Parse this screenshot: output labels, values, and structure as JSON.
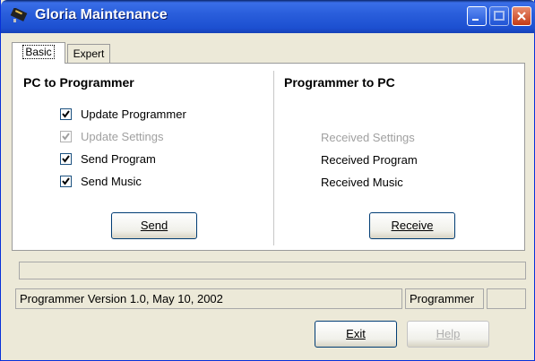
{
  "window": {
    "title": "Gloria Maintenance",
    "icon": "programmer-device-icon"
  },
  "tabs": [
    {
      "label": "Basic",
      "active": true
    },
    {
      "label": "Expert",
      "active": false
    }
  ],
  "pc_to_programmer": {
    "heading": "PC to Programmer",
    "options": [
      {
        "label": "Update Programmer",
        "checked": true,
        "enabled": true
      },
      {
        "label": "Update Settings",
        "checked": true,
        "enabled": false
      },
      {
        "label": "Send Program",
        "checked": true,
        "enabled": true
      },
      {
        "label": "Send Music",
        "checked": true,
        "enabled": true
      }
    ],
    "send_label": "Send"
  },
  "programmer_to_pc": {
    "heading": "Programmer to PC",
    "items": [
      {
        "label": "Received Settings",
        "enabled": false
      },
      {
        "label": "Received Program",
        "enabled": true
      },
      {
        "label": "Received Music",
        "enabled": true
      }
    ],
    "receive_label": "Receive"
  },
  "statusbar": {
    "version": "Programmer Version 1.0, May 10, 2002",
    "device": "Programmer",
    "extra": ""
  },
  "footer": {
    "exit_label": "Exit",
    "help_label": "Help"
  }
}
